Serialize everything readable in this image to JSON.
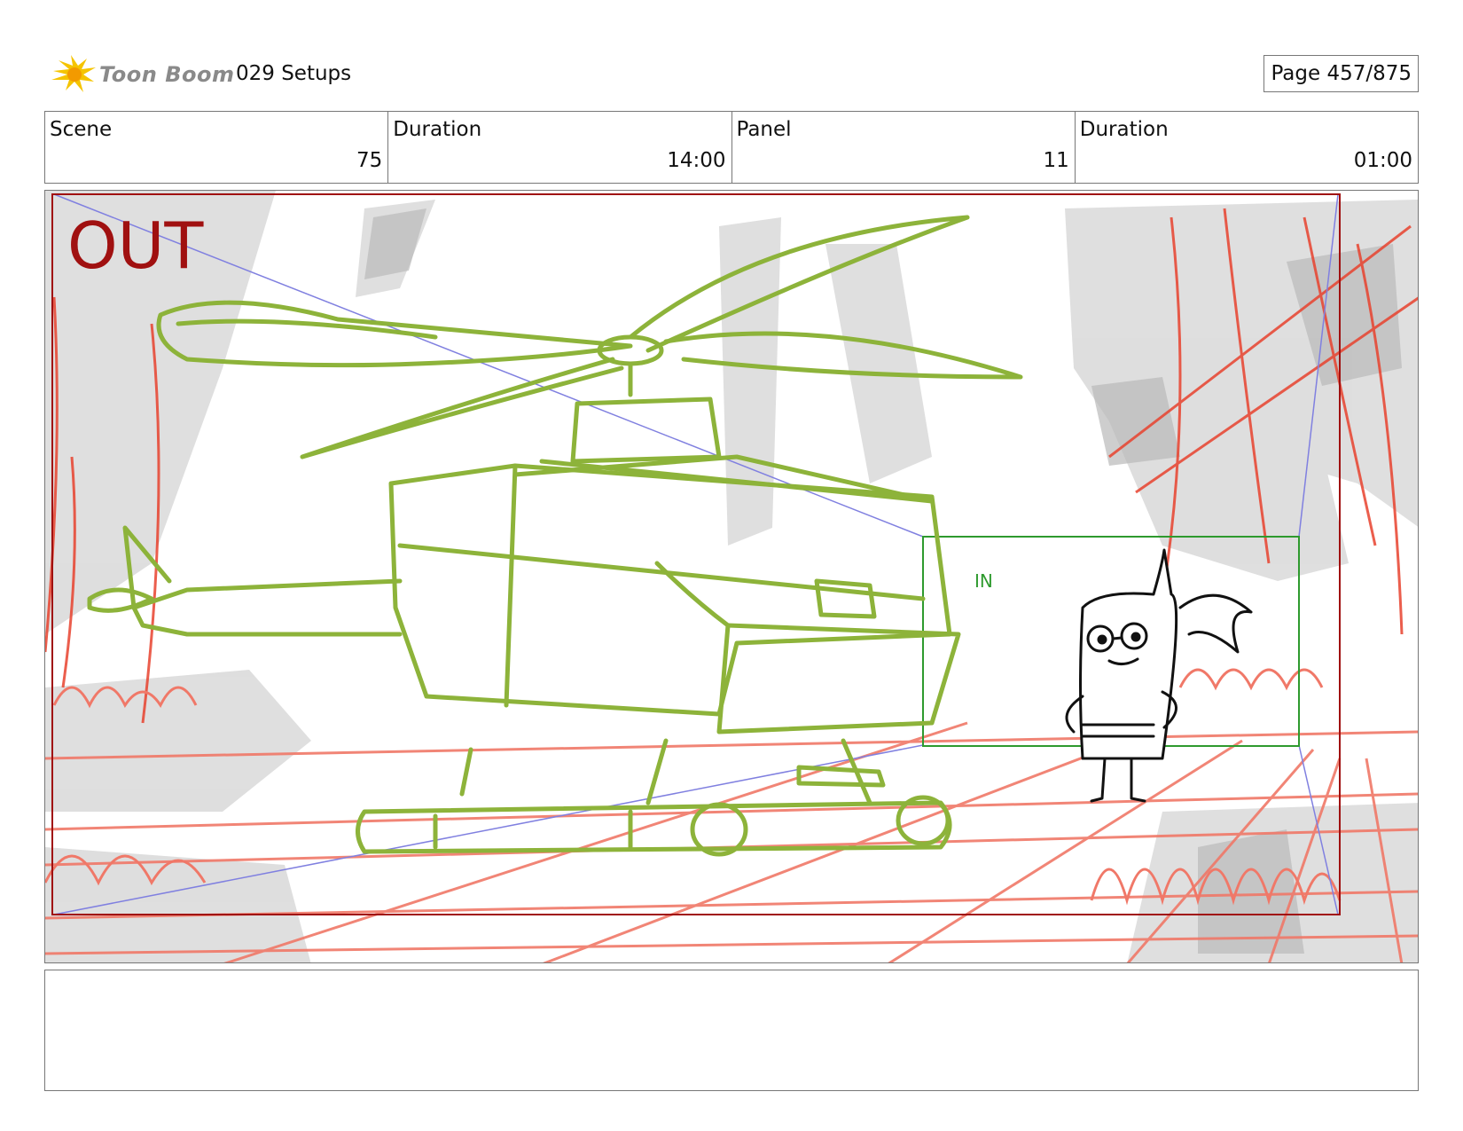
{
  "header": {
    "logo_text": "Toon Boom",
    "project_title": "029 Setups",
    "page_label": "Page 457/875",
    "logo_icon": "sunburst-logo-icon"
  },
  "info": {
    "scene_label": "Scene",
    "scene_value": "75",
    "scene_duration_label": "Duration",
    "scene_duration_value": "14:00",
    "panel_label": "Panel",
    "panel_value": "11",
    "panel_duration_label": "Duration",
    "panel_duration_value": "01:00"
  },
  "panel": {
    "out_label": "OUT",
    "in_label": "IN"
  },
  "caption": {
    "text": ""
  },
  "colors": {
    "out_frame": "#a01010",
    "in_frame": "#2e9a2e",
    "sketch_green": "#8db33a",
    "sketch_red": "#f07868",
    "logo_yellow": "#f5c400"
  }
}
